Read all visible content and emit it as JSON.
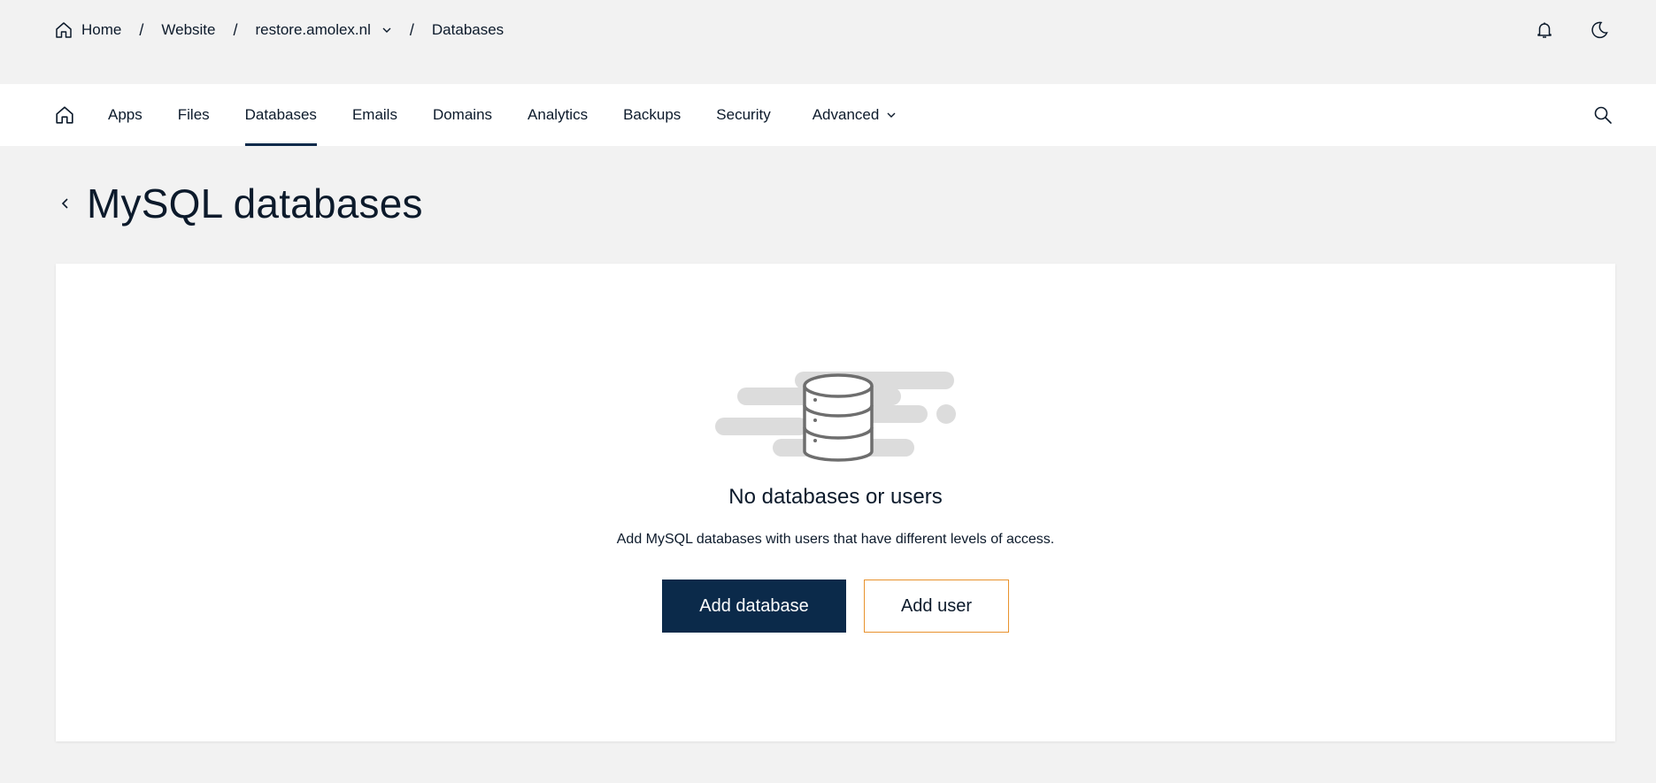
{
  "breadcrumb": {
    "home": "Home",
    "website": "Website",
    "site": "restore.amolex.nl",
    "current": "Databases",
    "separator": "/"
  },
  "topbar_icons": [
    "bell-icon",
    "moon-icon"
  ],
  "nav": {
    "items": [
      {
        "label": "Apps"
      },
      {
        "label": "Files"
      },
      {
        "label": "Databases",
        "active": true
      },
      {
        "label": "Emails"
      },
      {
        "label": "Domains"
      },
      {
        "label": "Analytics"
      },
      {
        "label": "Backups"
      },
      {
        "label": "Security"
      }
    ],
    "advanced_label": "Advanced"
  },
  "page": {
    "title": "MySQL databases"
  },
  "empty_state": {
    "title": "No databases or users",
    "description": "Add MySQL databases with users that have different levels of access.",
    "primary_button": "Add database",
    "secondary_button": "Add user"
  },
  "colors": {
    "primary": "#0b2a4a",
    "accent_border": "#e8922d",
    "background": "#f2f2f2",
    "text": "#0c1a2b"
  }
}
